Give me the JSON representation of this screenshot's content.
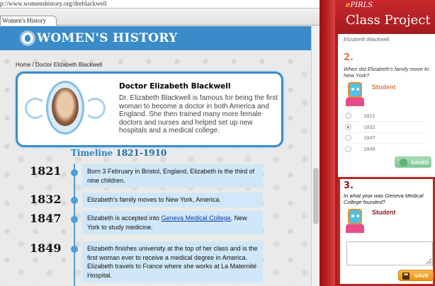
{
  "browser": {
    "url": "p://www.womenshistory.org/dreblackwell",
    "tab_title": "Women's History"
  },
  "site": {
    "title": "WOMEN'S HISTORY",
    "breadcrumb": "Home / Doctor Elizabeth Blackwell"
  },
  "bio": {
    "title": "Doctor Elizabeth Blackwell",
    "text": "Dr. Elizabeth Blackwell is famous for being the first woman to become a doctor in both America and England. She then trained many more female doctors and nurses and helped set up new hospitals and a medical college."
  },
  "timeline": {
    "heading": "Timeline",
    "range": "1821-1910",
    "entries": [
      {
        "year": "1821",
        "text": "Born 3 February in Bristol, England, Elizabeth is the third of nine children."
      },
      {
        "year": "1832",
        "text": "Elizabeth's family moves to New York, America."
      },
      {
        "year": "1847",
        "text_before": "Elizabeth is accepted into ",
        "link": "Geneva Medical College",
        "text_after": ", New York to study medicine."
      },
      {
        "year": "1849",
        "text": "Elizabeth finishes university at the top of her class and is the first woman ever to receive a medical degree in America. Elizabeth travels to France where she works at La Maternité Hospital."
      }
    ]
  },
  "panel": {
    "logo_e": "e",
    "logo_rest": "PIRLS",
    "title": "Class Project",
    "previous_answer": "Elizabeth Blackwell.",
    "q2": {
      "number": "2.",
      "text": "When did Elizabeth's family move to New York?",
      "student_label": "Student",
      "options": [
        "1821",
        "1832",
        "1847",
        "1849"
      ],
      "selected": "1832",
      "saved_label": "SAVED"
    },
    "q3": {
      "number": "3.",
      "text": "In what year was Geneva Medical College founded?",
      "student_label": "Student",
      "answer_value": "",
      "save_label": "SAVE"
    }
  },
  "colors": {
    "site_blue": "#3a8cc9",
    "timeline_box": "#cfe7f8",
    "panel_red": "#b21e1e",
    "q2_accent": "#e07a4a",
    "q3_accent": "#8a1a1a",
    "saved_green": "#7fc493",
    "save_orange": "#ec9216"
  }
}
